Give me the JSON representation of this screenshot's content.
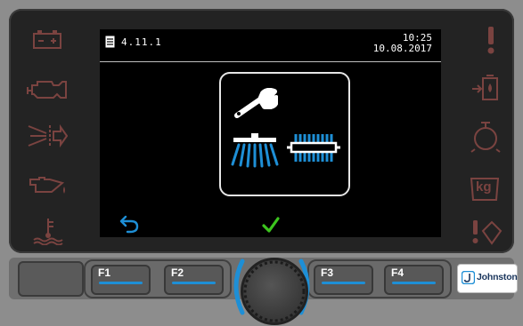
{
  "status_bar": {
    "version": "4.11.1",
    "time": "10:25",
    "date": "10.08.2017"
  },
  "dialog": {
    "icons": [
      "wrench-icon",
      "front-brush-icon",
      "roller-brush-icon"
    ]
  },
  "bottom_buttons": {
    "back_icon": "undo-arrow-icon",
    "confirm_icon": "checkmark-icon"
  },
  "left_indicators": [
    "battery-icon",
    "engine-check-icon",
    "hydraulic-filter-icon",
    "oil-pressure-icon",
    "coolant-temperature-icon"
  ],
  "right_indicators": [
    "warning-exclamation-icon",
    "fuel-water-separator-icon",
    "cyclone-filter-icon",
    "weight-kg-icon",
    "tilt-warning-icon"
  ],
  "indicator_text": {
    "weight_unit": "kg"
  },
  "function_keys": [
    "F1",
    "F2",
    "F3",
    "F4"
  ],
  "brand": {
    "name": "Johnston"
  },
  "colors": {
    "indicator_inactive": "#7a4340",
    "accent_blue": "#1e8fd6",
    "check_green": "#3cc41e",
    "dialog_border": "#e6e6e6"
  }
}
